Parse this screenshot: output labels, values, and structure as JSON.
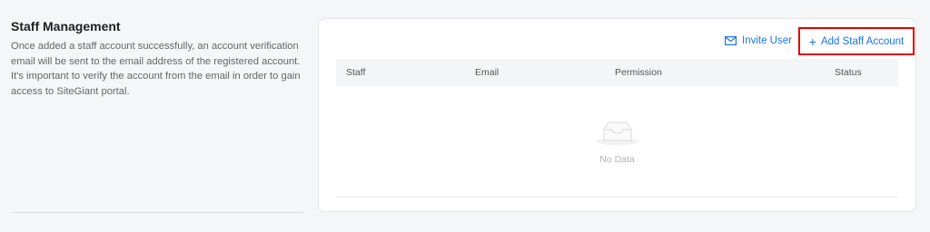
{
  "section": {
    "title": "Staff Management",
    "description": "Once added a staff account successfully, an account verification email will be sent to the email address of the registered account. It's important to verify the account from the email in order to gain access to SiteGiant portal."
  },
  "actions": {
    "invite_label": "Invite User",
    "add_label": "Add Staff Account",
    "invite_icon": "mail-icon",
    "add_icon": "plus-icon"
  },
  "table": {
    "columns": [
      "Staff",
      "Email",
      "Permission",
      "Status"
    ],
    "empty_text": "No Data",
    "empty_icon": "empty-inbox-icon"
  },
  "colors": {
    "accent": "#1a73e8",
    "highlight_border": "#e00000"
  }
}
